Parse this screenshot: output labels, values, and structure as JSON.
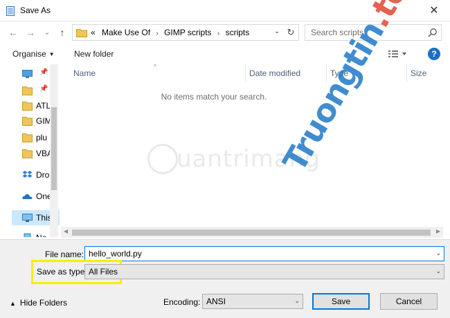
{
  "window": {
    "title": "Save As",
    "close_glyph": "✕"
  },
  "nav": {
    "back_glyph": "←",
    "forward_glyph": "→",
    "recent_glyph": "⌄",
    "up_glyph": "↑",
    "overflow_glyph": "«",
    "breadcrumbs": [
      "Make Use Of",
      "GIMP scripts",
      "scripts"
    ],
    "separator": "›",
    "refresh_glyph": "↻"
  },
  "search": {
    "placeholder": "Search scripts"
  },
  "toolbar": {
    "organise_label": "Organise",
    "new_folder_label": "New folder",
    "help_label": "?",
    "caret": "▼"
  },
  "navpane": {
    "pin_glyph": "📌",
    "items": [
      {
        "label": "",
        "icon": "desktop-icon"
      },
      {
        "label": "",
        "icon": "folder-icon"
      },
      {
        "label": "ATL",
        "icon": "folder-icon"
      },
      {
        "label": "GIM",
        "icon": "folder-icon"
      },
      {
        "label": "plu",
        "icon": "folder-icon"
      },
      {
        "label": "VBA",
        "icon": "folder-icon"
      },
      {
        "label": "Drop",
        "icon": "dropbox-icon"
      },
      {
        "label": "OneI",
        "icon": "onedrive-icon"
      },
      {
        "label": "This",
        "icon": "this-pc-icon"
      },
      {
        "label": "Ne",
        "icon": "network-icon"
      }
    ]
  },
  "filelist": {
    "columns": [
      "Name",
      "Date modified",
      "Type",
      "Size"
    ],
    "sort_glyph": "^",
    "empty_message": "No items match your search."
  },
  "form": {
    "file_name_label": "File name:",
    "file_name_value": "hello_world.py",
    "save_as_type_label": "Save as type:",
    "save_as_type_value": "All Files",
    "encoding_label": "Encoding:",
    "encoding_value": "ANSI",
    "dropdown_glyph": "⌄"
  },
  "footer": {
    "hide_folders_label": "Hide Folders",
    "hide_glyph": "▲",
    "save_label": "Save",
    "cancel_label": "Cancel"
  },
  "watermark": {
    "site": "uantrimang",
    "brand_main": "Truongtin",
    "brand_tail": ".top"
  },
  "colors": {
    "accent": "#0078d7",
    "highlight": "#f6f000",
    "selected_bg": "#cce8ff",
    "folder": "#f0c65a",
    "help_bg": "#1c6fc7"
  }
}
